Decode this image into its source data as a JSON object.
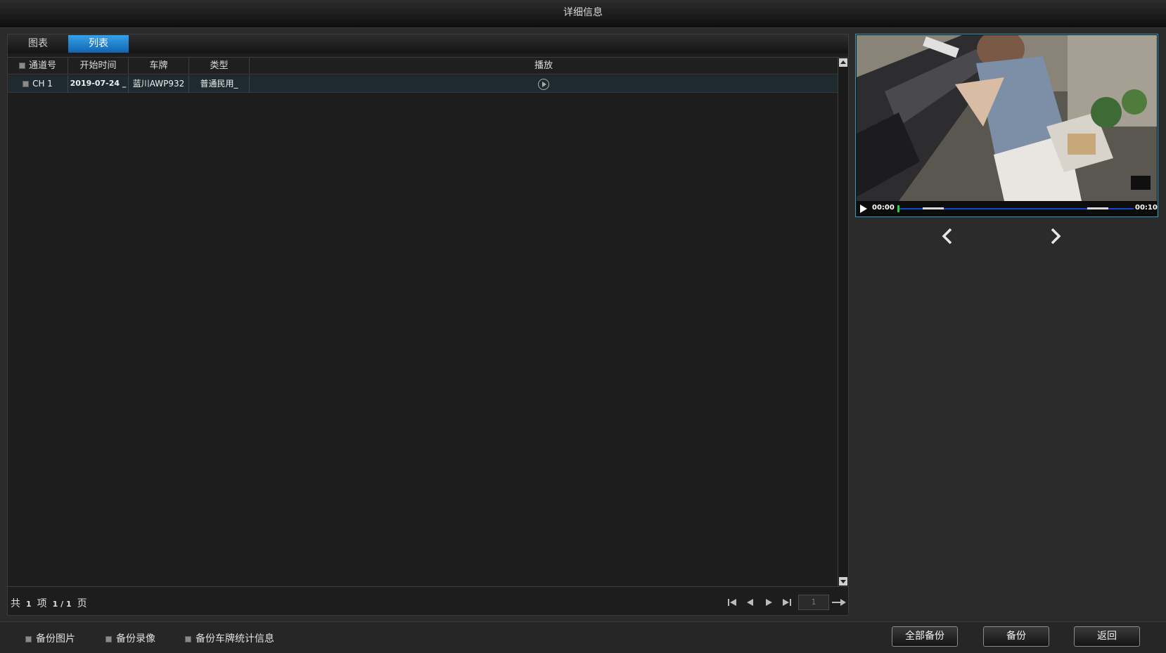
{
  "window": {
    "title": "详细信息"
  },
  "tabs": [
    {
      "label": "图表"
    },
    {
      "label": "列表"
    }
  ],
  "table": {
    "headers": [
      "通道号",
      "开始时间",
      "车牌",
      "类型",
      "播放"
    ],
    "rows": [
      {
        "channel": "CH 1",
        "start_time": "2019-07-24 _",
        "plate": "蓝川AWP932",
        "type": "普通民用_"
      }
    ]
  },
  "pager": {
    "total_prefix": "共",
    "total_count": "1",
    "item_unit": "项",
    "page_display": "1 / 1",
    "page_unit": "页",
    "page_input_value": "1"
  },
  "video": {
    "time_start": "00:00",
    "time_end": "00:10",
    "progress": 0.0
  },
  "bottom": {
    "options": [
      {
        "label": "备份图片"
      },
      {
        "label": "备份录像"
      },
      {
        "label": "备份车牌统计信息"
      }
    ],
    "buttons": {
      "backup_all": "全部备份",
      "backup": "备份",
      "back": "返回"
    }
  },
  "colors": {
    "accent": "#1a7fd0",
    "progress_bar": "#1346c9",
    "progress_cursor": "#36c93a",
    "preview_border": "#2e9ec0"
  }
}
